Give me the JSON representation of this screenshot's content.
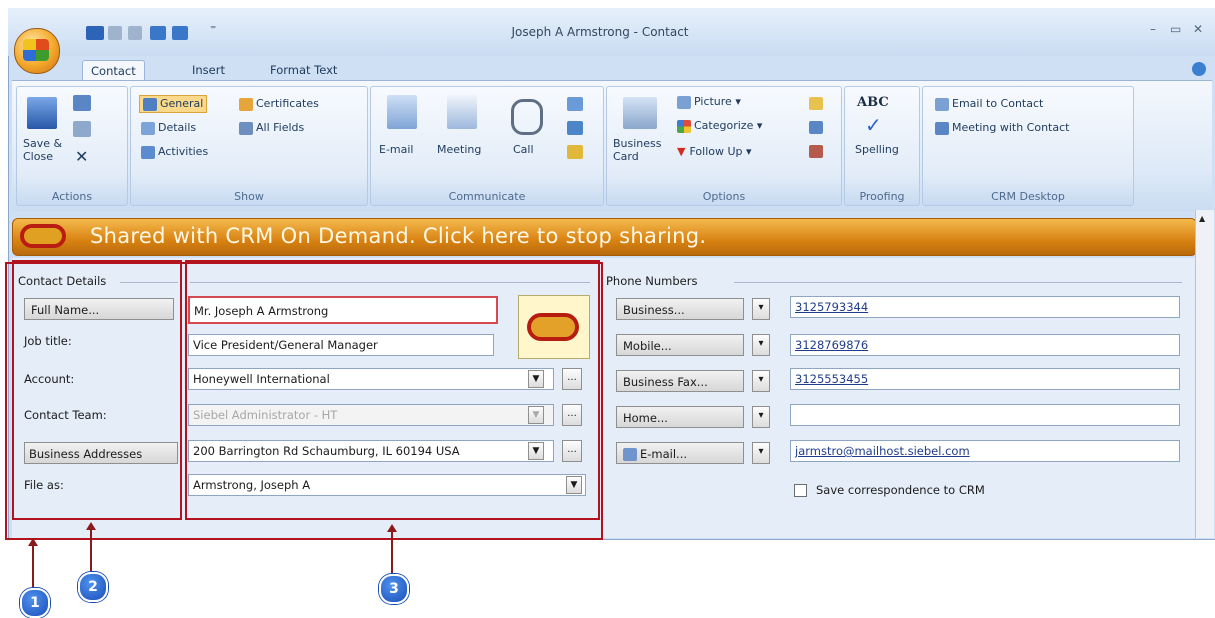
{
  "window": {
    "title": "Joseph A Armstrong - Contact",
    "controls": [
      "–",
      "▭",
      "✕"
    ]
  },
  "tabs": [
    "Contact",
    "Insert",
    "Format Text"
  ],
  "ribbon": {
    "actions": {
      "label": "Actions",
      "save_close": "Save & Close"
    },
    "show": {
      "label": "Show",
      "general": "General",
      "details": "Details",
      "activities": "Activities",
      "certificates": "Certificates",
      "all_fields": "All Fields"
    },
    "communicate": {
      "label": "Communicate",
      "email": "E-mail",
      "meeting": "Meeting",
      "call": "Call"
    },
    "options": {
      "label": "Options",
      "business_card": "Business Card",
      "picture": "Picture",
      "categorize": "Categorize",
      "follow_up": "Follow Up"
    },
    "proofing": {
      "label": "Proofing",
      "spelling": "Spelling",
      "abc": "ABC"
    },
    "crm": {
      "label": "CRM Desktop",
      "email_to_contact": "Email to Contact",
      "meeting_with_contact": "Meeting with Contact"
    }
  },
  "banner": {
    "text": "Shared with CRM On Demand. Click here to stop sharing."
  },
  "contact_details": {
    "section_title": "Contact Details",
    "full_name_btn": "Full Name...",
    "full_name": "Mr. Joseph A Armstrong",
    "job_title_label": "Job title:",
    "job_title": "Vice President/General  Manager",
    "account_label": "Account:",
    "account": "Honeywell International",
    "team_label": "Contact Team:",
    "team": "Siebel Administrator - HT",
    "addresses_btn": "Business Addresses",
    "address": "200 Barrington Rd Schaumburg, IL 60194 USA",
    "file_as_label": "File as:",
    "file_as": "Armstrong, Joseph A",
    "ellipsis": "..."
  },
  "phone_numbers": {
    "section_title": "Phone Numbers",
    "rows": [
      {
        "label": "Business...",
        "value": "3125793344"
      },
      {
        "label": "Mobile...",
        "value": "3128769876"
      },
      {
        "label": "Business Fax...",
        "value": "3125553455"
      },
      {
        "label": "Home...",
        "value": ""
      },
      {
        "label": "E-mail...",
        "value": "jarmstro@mailhost.siebel.com"
      }
    ],
    "save_correspondence": "Save correspondence to CRM"
  },
  "callouts": [
    "1",
    "2",
    "3"
  ],
  "colors": {
    "accent_red": "#b3121f",
    "banner_orange": "#d88212",
    "callout_blue": "#1a4eb9"
  }
}
